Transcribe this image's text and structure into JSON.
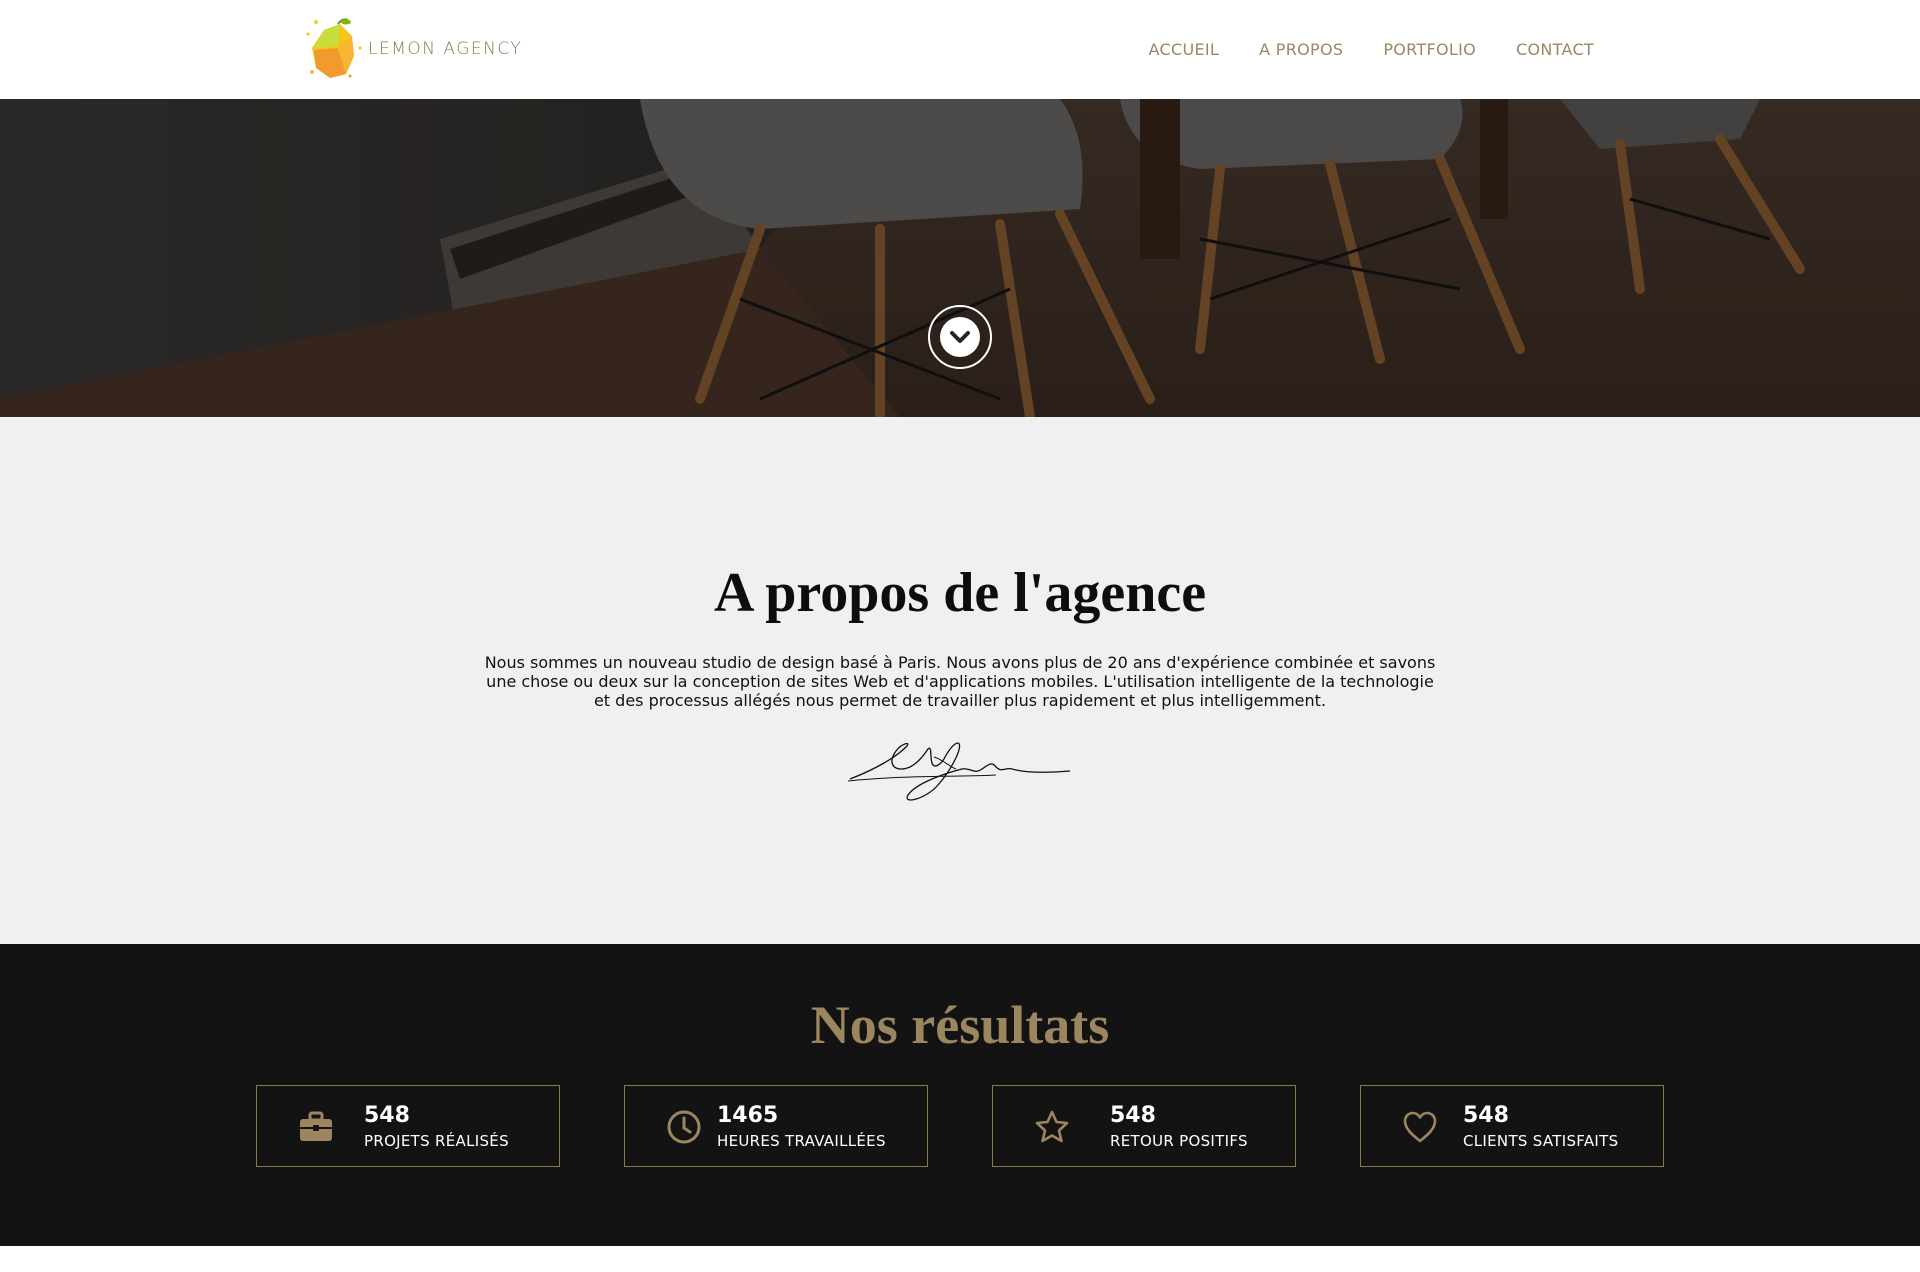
{
  "header": {
    "logo_text": "LEMON AGENCY",
    "nav": [
      "ACCUEIL",
      "A PROPOS",
      "PORTFOLIO",
      "CONTACT"
    ]
  },
  "hero": {
    "scroll_icon": "chevron-down-icon"
  },
  "about": {
    "title": "A propos de l'agence",
    "body": "Nous sommes un nouveau studio de design basé à Paris. Nous avons plus de 20 ans d'expérience combinée et savons une chose ou deux sur la conception de sites Web et d'applications mobiles. L'utilisation intelligente de la technologie et des processus allégés nous permet de travailler plus rapidement et plus intelligemment."
  },
  "results": {
    "title": "Nos résultats",
    "stats": [
      {
        "value": "548",
        "label": "PROJETS RÉALISÉS",
        "icon": "briefcase-icon"
      },
      {
        "value": "1465",
        "label": "HEURES TRAVAILLÉES",
        "icon": "clock-icon"
      },
      {
        "value": "548",
        "label": "RETOUR POSITIFS",
        "icon": "star-icon"
      },
      {
        "value": "548",
        "label": "CLIENTS SATISFAITS",
        "icon": "heart-icon"
      }
    ]
  },
  "colors": {
    "accent": "#9c8660",
    "dark_bg": "#131313",
    "light_bg": "#f0f0f0"
  }
}
